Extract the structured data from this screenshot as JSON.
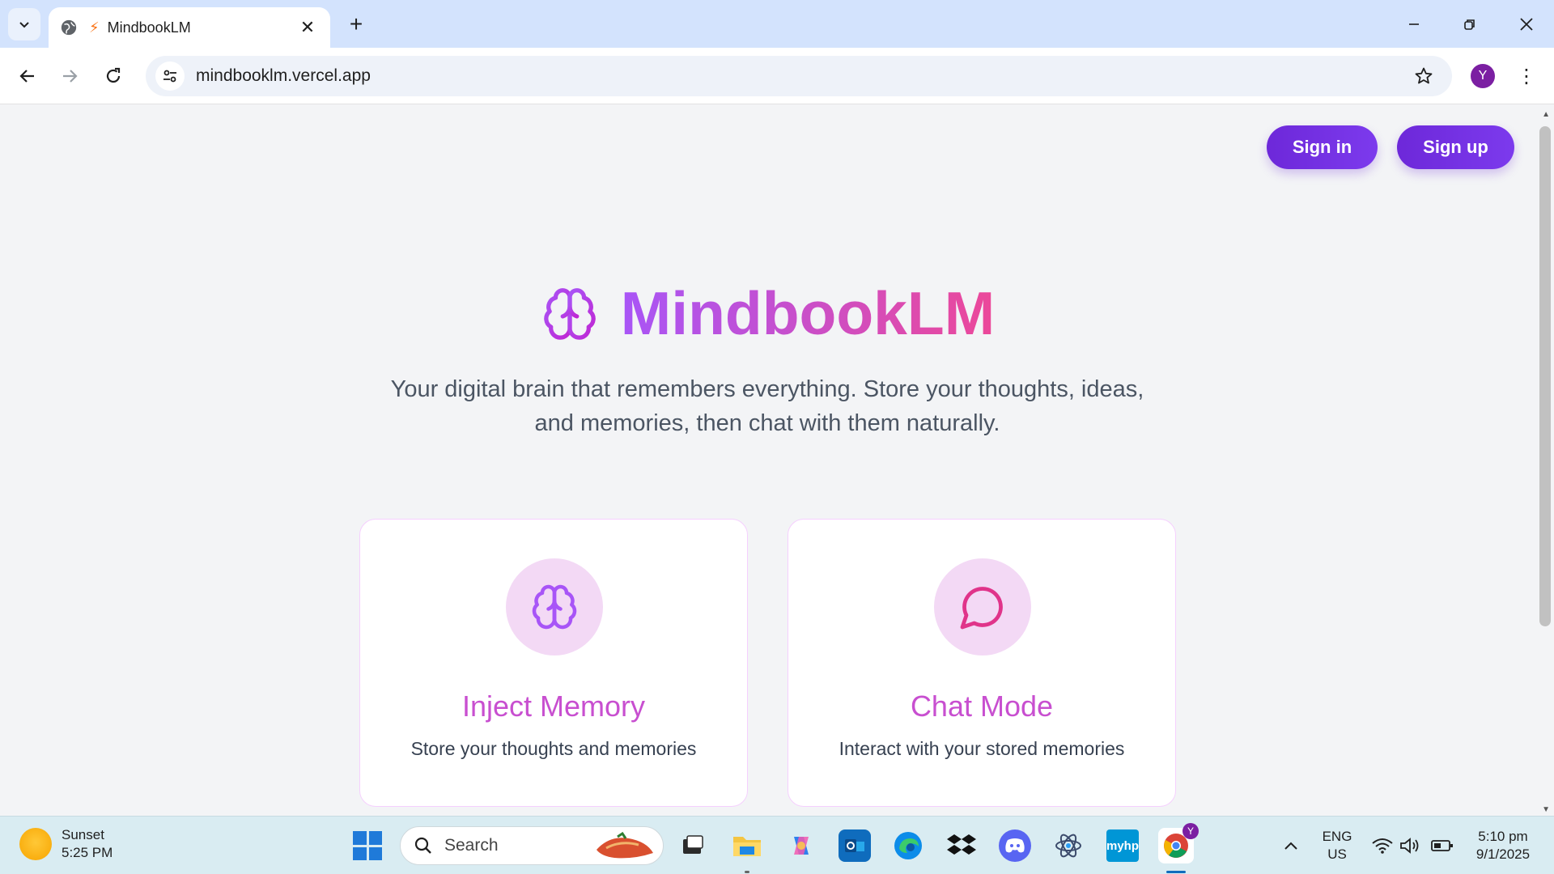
{
  "browser": {
    "tab_title": "MindbookLM",
    "url": "mindbooklm.vercel.app",
    "profile_initial": "Y"
  },
  "page": {
    "sign_in": "Sign in",
    "sign_up": "Sign up",
    "brand": "MindbookLM",
    "tagline_line1": "Your digital brain that remembers everything. Store your thoughts, ideas,",
    "tagline_line2": "and memories, then chat with them naturally.",
    "cards": [
      {
        "title": "Inject Memory",
        "description": "Store your thoughts and memories",
        "icon": "brain-icon"
      },
      {
        "title": "Chat Mode",
        "description": "Interact with your stored memories",
        "icon": "chat-bubble-icon"
      }
    ],
    "colors": {
      "button": "#6d28d9",
      "gradient_start": "#a855f7",
      "gradient_end": "#ec4899",
      "card_title": "#c84fd0"
    }
  },
  "taskbar": {
    "weather_label": "Sunset",
    "weather_time": "5:25 PM",
    "search_placeholder": "Search",
    "lang_top": "ENG",
    "lang_bottom": "US",
    "clock_time": "5:10 pm",
    "clock_date": "9/1/2025",
    "hp_label": "myhp",
    "chrome_badge": "Y"
  }
}
